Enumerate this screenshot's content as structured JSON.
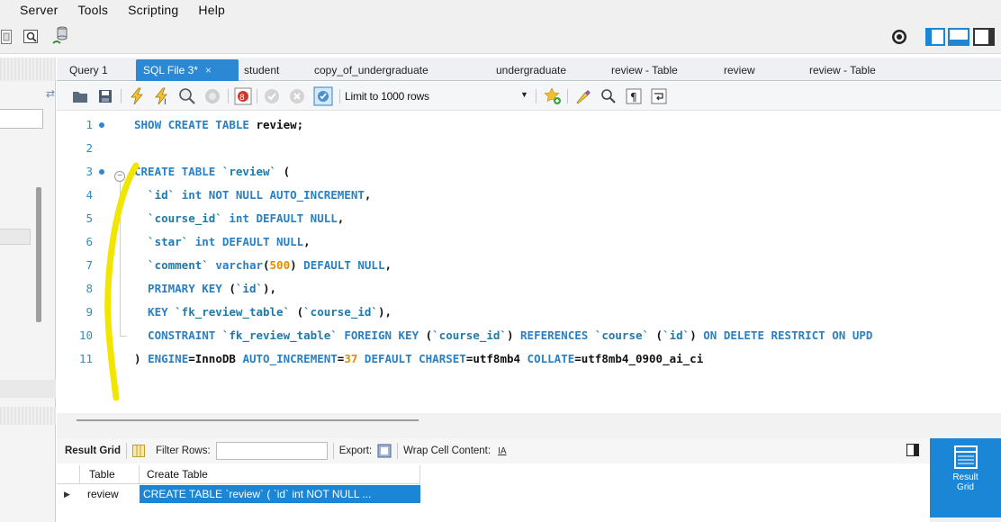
{
  "menubar": {
    "items": [
      "Server",
      "Tools",
      "Scripting",
      "Help"
    ]
  },
  "tabs": [
    {
      "label": "Query 1",
      "active": false
    },
    {
      "label": "SQL File 3*",
      "active": true,
      "close": "×"
    },
    {
      "label": "student",
      "active": false
    },
    {
      "label": "copy_of_undergraduate",
      "active": false
    },
    {
      "label": "undergraduate",
      "active": false
    },
    {
      "label": "review - Table",
      "active": false
    },
    {
      "label": "review",
      "active": false
    },
    {
      "label": "review - Table",
      "active": false
    }
  ],
  "sql_toolbar": {
    "limit_select": "Limit to 1000 rows"
  },
  "editor": {
    "lines": [
      {
        "n": "1",
        "bullet": true,
        "tokens": [
          [
            "kw",
            "SHOW CREATE TABLE "
          ],
          [
            "plain",
            "review;"
          ]
        ]
      },
      {
        "n": "2",
        "bullet": false,
        "tokens": []
      },
      {
        "n": "3",
        "bullet": true,
        "fold": true,
        "tokens": [
          [
            "kw",
            "CREATE TABLE "
          ],
          [
            "bt",
            "`review`"
          ],
          [
            "plain",
            " ("
          ]
        ]
      },
      {
        "n": "4",
        "bullet": false,
        "tokens": [
          [
            "bt",
            "  `id` "
          ],
          [
            "kw",
            "int NOT NULL AUTO_INCREMENT"
          ],
          [
            "plain",
            ","
          ]
        ]
      },
      {
        "n": "5",
        "bullet": false,
        "tokens": [
          [
            "bt",
            "  `course_id` "
          ],
          [
            "kw",
            "int DEFAULT NULL"
          ],
          [
            "plain",
            ","
          ]
        ]
      },
      {
        "n": "6",
        "bullet": false,
        "tokens": [
          [
            "bt",
            "  `star` "
          ],
          [
            "kw",
            "int DEFAULT NULL"
          ],
          [
            "plain",
            ","
          ]
        ]
      },
      {
        "n": "7",
        "bullet": false,
        "tokens": [
          [
            "bt",
            "  `comment` "
          ],
          [
            "kw",
            "varchar"
          ],
          [
            "plain",
            "("
          ],
          [
            "num",
            "500"
          ],
          [
            "plain",
            ") "
          ],
          [
            "kw",
            "DEFAULT NULL"
          ],
          [
            "plain",
            ","
          ]
        ]
      },
      {
        "n": "8",
        "bullet": false,
        "tokens": [
          [
            "kw",
            "  PRIMARY KEY "
          ],
          [
            "plain",
            "("
          ],
          [
            "bt",
            "`id`"
          ],
          [
            "plain",
            "),"
          ]
        ]
      },
      {
        "n": "9",
        "bullet": false,
        "tokens": [
          [
            "kw",
            "  KEY "
          ],
          [
            "bt",
            "`fk_review_table` "
          ],
          [
            "plain",
            "("
          ],
          [
            "bt",
            "`course_id`"
          ],
          [
            "plain",
            "),"
          ]
        ]
      },
      {
        "n": "10",
        "bullet": false,
        "tokens": [
          [
            "kw",
            "  CONSTRAINT "
          ],
          [
            "bt",
            "`fk_review_table` "
          ],
          [
            "kw",
            "FOREIGN KEY "
          ],
          [
            "plain",
            "("
          ],
          [
            "bt",
            "`course_id`"
          ],
          [
            "plain",
            ") "
          ],
          [
            "kw",
            "REFERENCES "
          ],
          [
            "bt",
            "`course` "
          ],
          [
            "plain",
            "("
          ],
          [
            "bt",
            "`id`"
          ],
          [
            "plain",
            ") "
          ],
          [
            "kw",
            "ON DELETE RESTRICT ON UPD"
          ]
        ]
      },
      {
        "n": "11",
        "bullet": false,
        "tokens": [
          [
            "plain",
            ") "
          ],
          [
            "kw",
            "ENGINE"
          ],
          [
            "plain",
            "=InnoDB "
          ],
          [
            "kw",
            "AUTO_INCREMENT"
          ],
          [
            "plain",
            "="
          ],
          [
            "num",
            "37"
          ],
          [
            "kw",
            " DEFAULT CHARSET"
          ],
          [
            "plain",
            "=utf8mb4 "
          ],
          [
            "kw",
            "COLLATE"
          ],
          [
            "plain",
            "=utf8mb4_0900_ai_ci"
          ]
        ]
      }
    ]
  },
  "result_toolbar": {
    "result_grid": "Result Grid",
    "filter_rows": "Filter Rows:",
    "export": "Export:",
    "wrap": "Wrap Cell Content:",
    "wrap_icon": "IA"
  },
  "result_grid": {
    "columns": [
      "Table",
      "Create Table"
    ],
    "rows": [
      {
        "marker": "▶",
        "table": "review",
        "create": "CREATE TABLE `review` (  `id` int NOT NULL ..."
      }
    ]
  },
  "right_panel": {
    "result_grid_label_1": "Result",
    "result_grid_label_2": "Grid"
  },
  "colors": {
    "accent": "#2a88d4",
    "annotation": "#f2e600"
  }
}
